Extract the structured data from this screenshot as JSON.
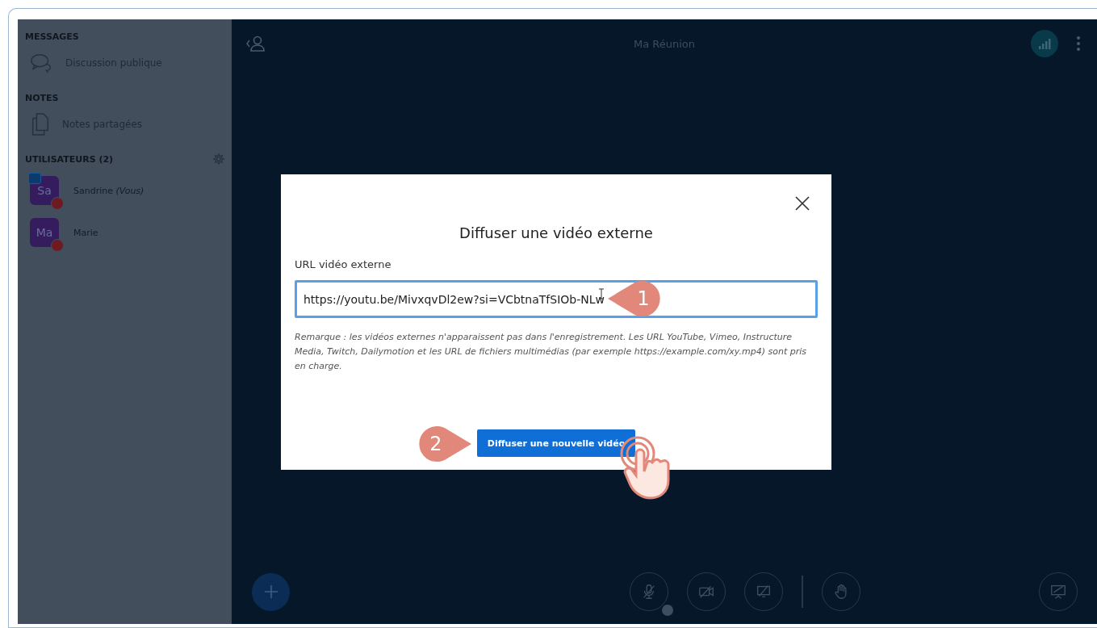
{
  "sidebar": {
    "sections": [
      {
        "kind": "messages",
        "heading": "MESSAGES",
        "items": [
          {
            "kind": "chat",
            "label": "Discussion publique"
          }
        ]
      },
      {
        "kind": "notes",
        "heading": "NOTES",
        "items": [
          {
            "kind": "notes",
            "label": "Notes partagées"
          }
        ]
      },
      {
        "kind": "users",
        "heading": "UTILISATEURS (2)"
      }
    ],
    "users": [
      {
        "initials": "Sa",
        "name": "Sandrine *(Vous)*",
        "presenter": true
      },
      {
        "initials": "Ma",
        "name": "Marie",
        "presenter": false
      }
    ]
  },
  "topbar": {
    "title": "Ma Réunion"
  },
  "modal": {
    "title": "Diffuser une vidéo externe",
    "label": "URL vidéo externe",
    "value": "https://youtu.be/MivxqvDl2ew?si=VCbtnaTfSIOb-NLw",
    "note": "Remarque : les vidéos externes n'apparaissent pas dans l'enregistrement. Les URL YouTube, Vimeo, Instructure Media, Twitch, Dailymotion et les URL de fichiers multimédias (par exemple https://example.com/xy.mp4) sont pris en charge.",
    "button": "Diffuser une nouvelle vidéo"
  },
  "callouts": [
    "1",
    "2"
  ]
}
